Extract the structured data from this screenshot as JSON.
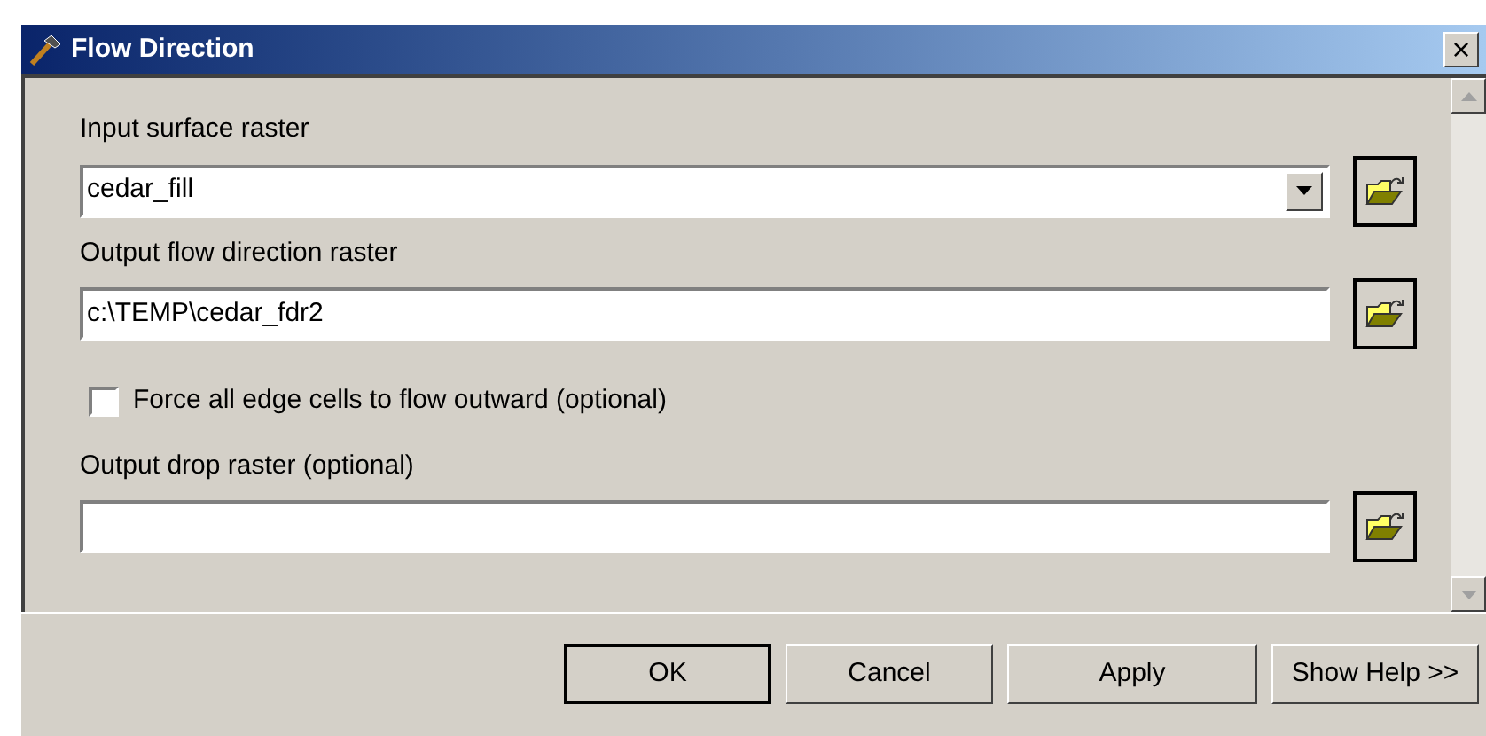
{
  "window": {
    "title": "Flow Direction",
    "close": "×"
  },
  "fields": [
    {
      "kind": "dropdown",
      "label": "Input surface raster",
      "value": "cedar_fill"
    },
    {
      "kind": "text",
      "label": "Output flow direction raster",
      "value": "c:\\TEMP\\cedar_fdr2"
    },
    {
      "kind": "checkbox",
      "label": "Force all edge cells to flow outward (optional)",
      "checked": false
    },
    {
      "kind": "text",
      "label": "Output drop raster (optional)"
    }
  ],
  "buttons": [
    {
      "label": "OK",
      "default": true
    },
    {
      "label": "Cancel",
      "default": false
    },
    {
      "label": "Apply",
      "default": false
    },
    {
      "label": "Show Help >>",
      "default": false
    }
  ]
}
